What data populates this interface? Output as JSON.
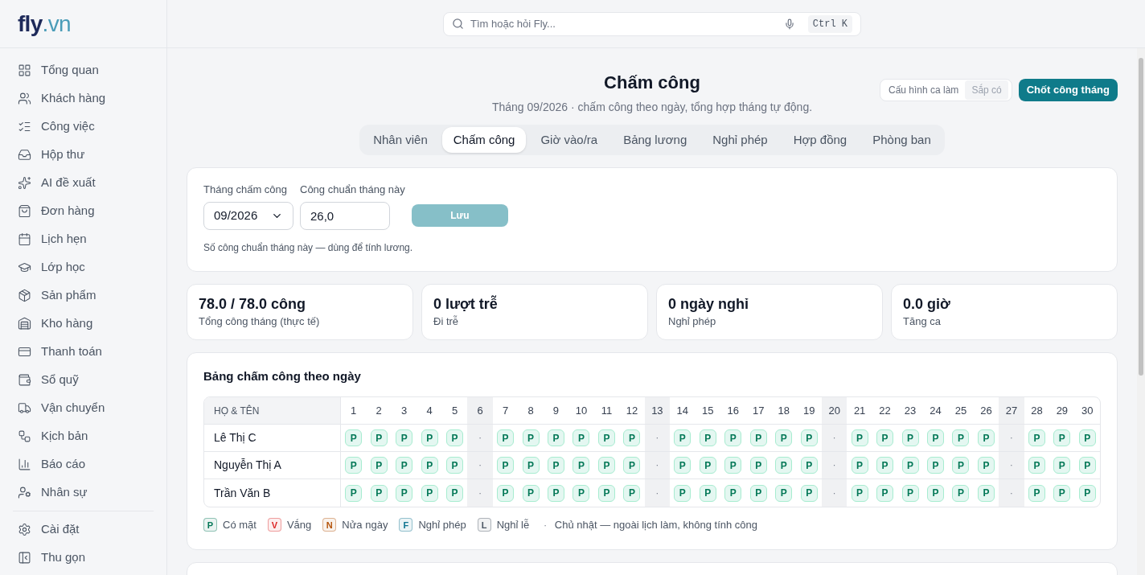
{
  "logo": {
    "brand": "fly",
    "tld": ".vn"
  },
  "search": {
    "placeholder": "Tìm hoặc hỏi Fly...",
    "shortcut": "Ctrl K"
  },
  "sidebar": {
    "items": [
      {
        "label": "Tổng quan"
      },
      {
        "label": "Khách hàng"
      },
      {
        "label": "Công việc"
      },
      {
        "label": "Hộp thư"
      },
      {
        "label": "AI đề xuất"
      },
      {
        "label": "Đơn hàng"
      },
      {
        "label": "Lịch hẹn"
      },
      {
        "label": "Lớp học"
      },
      {
        "label": "Sản phẩm"
      },
      {
        "label": "Kho hàng"
      },
      {
        "label": "Thanh toán"
      },
      {
        "label": "Sổ quỹ"
      },
      {
        "label": "Vận chuyển"
      },
      {
        "label": "Kịch bản"
      },
      {
        "label": "Báo cáo"
      },
      {
        "label": "Nhân sự"
      }
    ],
    "footer": [
      {
        "label": "Cài đặt"
      },
      {
        "label": "Thu gọn"
      }
    ]
  },
  "page": {
    "title": "Chấm công",
    "subtitle": "Tháng 09/2026 · chấm công theo ngày, tổng hợp tháng tự động.",
    "shift_config": {
      "label": "Cấu hình ca làm",
      "badge": "Sắp có",
      "disabled": true
    },
    "primary_button": "Chốt công tháng"
  },
  "tabs": [
    {
      "label": "Nhân viên",
      "selected": false
    },
    {
      "label": "Chấm công",
      "selected": true
    },
    {
      "label": "Giờ vào/ra",
      "selected": false
    },
    {
      "label": "Bảng lương",
      "selected": false
    },
    {
      "label": "Nghỉ phép",
      "selected": false
    },
    {
      "label": "Hợp đồng",
      "selected": false
    },
    {
      "label": "Phòng ban",
      "selected": false
    }
  ],
  "settings": {
    "month_label": "Tháng chấm công",
    "month_value": "09/2026",
    "standard_label": "Công chuẩn tháng này",
    "standard_value": "26,0",
    "save_button": "Lưu",
    "save_disabled": true,
    "hint": "Số công chuẩn tháng này — dùng để tính lương."
  },
  "stats": [
    {
      "value": "78.0 / 78.0 công",
      "label": "Tổng công tháng (thực tế)"
    },
    {
      "value": "0 lượt trễ",
      "label": "Đi trễ"
    },
    {
      "value": "0 ngày nghỉ",
      "label": "Nghỉ phép"
    },
    {
      "value": "0.0 giờ",
      "label": "Tăng ca"
    }
  ],
  "attendance": {
    "title": "Bảng chấm công theo ngày",
    "name_header": "HỌ & TÊN",
    "days": [
      {
        "label": "1",
        "off": false
      },
      {
        "label": "2",
        "off": false
      },
      {
        "label": "3",
        "off": false
      },
      {
        "label": "4",
        "off": false
      },
      {
        "label": "5",
        "off": false
      },
      {
        "label": "6",
        "off": true
      },
      {
        "label": "7",
        "off": false
      },
      {
        "label": "8",
        "off": false
      },
      {
        "label": "9",
        "off": false
      },
      {
        "label": "10",
        "off": false
      },
      {
        "label": "11",
        "off": false
      },
      {
        "label": "12",
        "off": false
      },
      {
        "label": "13",
        "off": true
      },
      {
        "label": "14",
        "off": false
      },
      {
        "label": "15",
        "off": false
      },
      {
        "label": "16",
        "off": false
      },
      {
        "label": "17",
        "off": false
      },
      {
        "label": "18",
        "off": false
      },
      {
        "label": "19",
        "off": false
      },
      {
        "label": "20",
        "off": true
      },
      {
        "label": "21",
        "off": false
      },
      {
        "label": "22",
        "off": false
      },
      {
        "label": "23",
        "off": false
      },
      {
        "label": "24",
        "off": false
      },
      {
        "label": "25",
        "off": false
      },
      {
        "label": "26",
        "off": false
      },
      {
        "label": "27",
        "off": true
      },
      {
        "label": "28",
        "off": false
      },
      {
        "label": "29",
        "off": false
      },
      {
        "label": "30",
        "off": false
      }
    ],
    "rows": [
      {
        "name": "Lê Thị C",
        "cells": [
          "P",
          "P",
          "P",
          "P",
          "P",
          "·",
          "P",
          "P",
          "P",
          "P",
          "P",
          "P",
          "·",
          "P",
          "P",
          "P",
          "P",
          "P",
          "P",
          "·",
          "P",
          "P",
          "P",
          "P",
          "P",
          "P",
          "·",
          "P",
          "P",
          "P"
        ]
      },
      {
        "name": "Nguyễn Thị A",
        "cells": [
          "P",
          "P",
          "P",
          "P",
          "P",
          "·",
          "P",
          "P",
          "P",
          "P",
          "P",
          "P",
          "·",
          "P",
          "P",
          "P",
          "P",
          "P",
          "P",
          "·",
          "P",
          "P",
          "P",
          "P",
          "P",
          "P",
          "·",
          "P",
          "P",
          "P"
        ]
      },
      {
        "name": "Trần Văn B",
        "cells": [
          "P",
          "P",
          "P",
          "P",
          "P",
          "·",
          "P",
          "P",
          "P",
          "P",
          "P",
          "P",
          "·",
          "P",
          "P",
          "P",
          "P",
          "P",
          "P",
          "·",
          "P",
          "P",
          "P",
          "P",
          "P",
          "P",
          "·",
          "P",
          "P",
          "P"
        ]
      }
    ],
    "legend": [
      {
        "kind": "badge",
        "code": "P",
        "label": "Có mặt",
        "color": "#047857"
      },
      {
        "kind": "badge",
        "code": "V",
        "label": "Vắng",
        "color": "#dc2626"
      },
      {
        "kind": "badge",
        "code": "N",
        "label": "Nửa ngày",
        "color": "#b45309"
      },
      {
        "kind": "badge",
        "code": "F",
        "label": "Nghỉ phép",
        "color": "#0e7490"
      },
      {
        "kind": "badge",
        "code": "L",
        "label": "Nghỉ lễ",
        "color": "#4b5563"
      },
      {
        "kind": "dot",
        "code": "·",
        "label": "Chủ nhật — ngoài lịch làm, không tính công"
      }
    ]
  }
}
